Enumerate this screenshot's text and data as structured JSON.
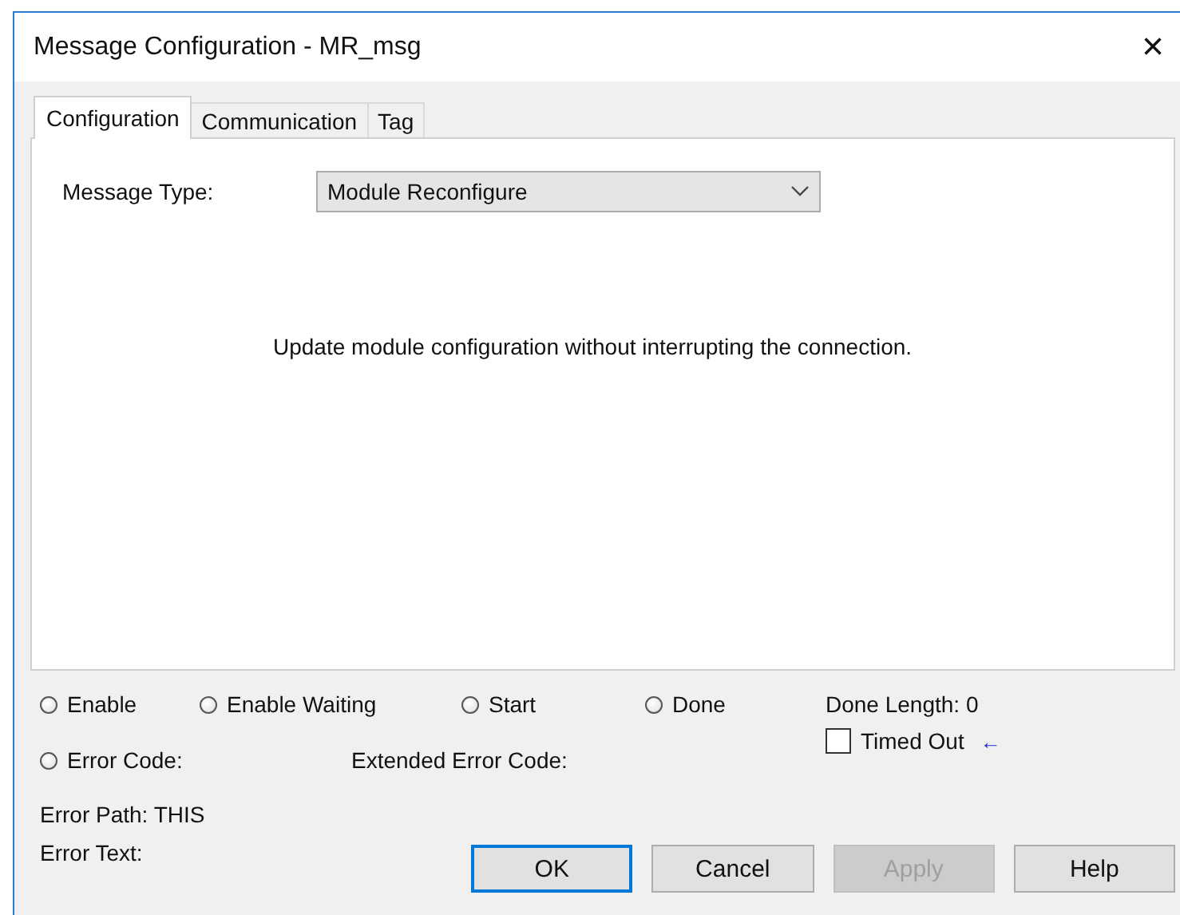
{
  "window": {
    "title": "Message Configuration - MR_msg",
    "close": "×"
  },
  "tabs": [
    {
      "label": "Configuration",
      "selected": true
    },
    {
      "label": "Communication",
      "selected": false
    },
    {
      "label": "Tag",
      "selected": false
    }
  ],
  "message_type": {
    "label": "Message Type:",
    "value": "Module Reconfigure"
  },
  "description": "Update module configuration without interrupting the connection.",
  "status_lights": [
    {
      "label": "Enable",
      "on": false
    },
    {
      "label": "Enable Waiting",
      "on": false
    },
    {
      "label": "Start",
      "on": false
    },
    {
      "label": "Done",
      "on": false
    }
  ],
  "done_length": {
    "label": "Done Length:",
    "value": "0"
  },
  "error_code": {
    "label": "Error Code:",
    "on": false
  },
  "extended_error_code": {
    "label": "Extended Error Code:"
  },
  "timed_out": {
    "label": "Timed Out",
    "checked": false,
    "arrow": "←"
  },
  "error_path": {
    "label": "Error Path:",
    "value": "THIS"
  },
  "error_text": {
    "label": "Error Text:"
  },
  "buttons": [
    {
      "label": "OK",
      "default": true,
      "disabled": false
    },
    {
      "label": "Cancel",
      "default": false,
      "disabled": false
    },
    {
      "label": "Apply",
      "default": false,
      "disabled": true
    },
    {
      "label": "Help",
      "default": false,
      "disabled": false
    }
  ]
}
